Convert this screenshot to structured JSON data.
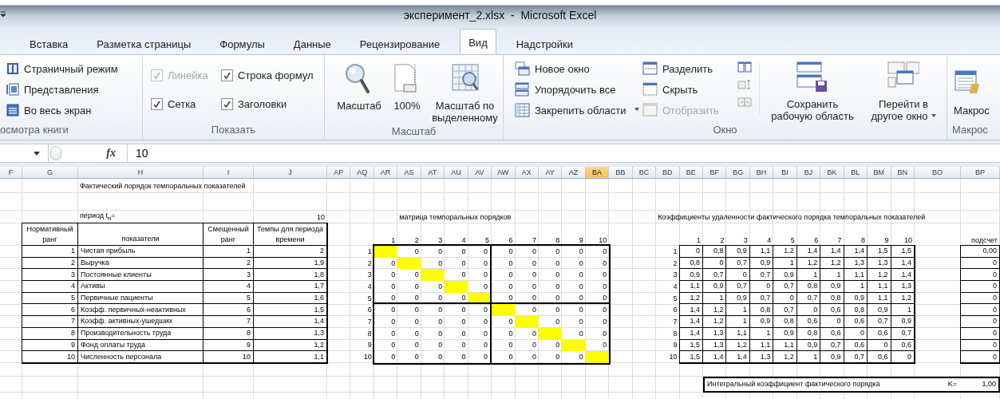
{
  "window": {
    "title": "эксперимент_2.xlsx  -  Microsoft Excel"
  },
  "ribbon_tabs": [
    {
      "label": "Вставка",
      "selected": false
    },
    {
      "label": "Разметка страницы",
      "selected": false
    },
    {
      "label": "Формулы",
      "selected": false
    },
    {
      "label": "Данные",
      "selected": false
    },
    {
      "label": "Рецензирование",
      "selected": false
    },
    {
      "label": "Вид",
      "selected": true
    },
    {
      "label": "Надстройки",
      "selected": false
    }
  ],
  "ribbon_groups": [
    {
      "kind": "views",
      "label": "осмотра книги",
      "items": [
        {
          "label": "Страничный режим"
        },
        {
          "label": "Представления"
        },
        {
          "label": "Во весь экран"
        }
      ]
    },
    {
      "kind": "show",
      "label": "Показать",
      "items": [
        {
          "label": "Линейка",
          "checked": true,
          "disabled": true
        },
        {
          "label": "Строка формул",
          "checked": true,
          "disabled": false
        },
        {
          "label": "Сетка",
          "checked": true,
          "disabled": false
        },
        {
          "label": "Заголовки",
          "checked": true,
          "disabled": false
        }
      ]
    },
    {
      "kind": "zoom",
      "label": "Масштаб",
      "items": [
        {
          "label": "Масштаб"
        },
        {
          "label": "100%"
        },
        {
          "label": "Масштаб по выделенному"
        }
      ]
    },
    {
      "kind": "window",
      "label": "Окно",
      "items": [
        {
          "label": "Новое окно",
          "disabled": false,
          "menu": false
        },
        {
          "label": "Упорядочить все",
          "disabled": false,
          "menu": false
        },
        {
          "label": "Закрепить области",
          "disabled": false,
          "menu": true
        },
        {
          "label": "Разделить",
          "disabled": false,
          "menu": false
        },
        {
          "label": "Скрыть",
          "disabled": false,
          "menu": false
        },
        {
          "label": "Отобразить",
          "disabled": true,
          "menu": false
        },
        {
          "label": "Сохранить рабочую область",
          "disabled": false,
          "menu": false
        },
        {
          "label": "Перейти в другое окно",
          "disabled": false,
          "menu": true
        }
      ]
    },
    {
      "kind": "macros",
      "label": "Макрос",
      "items": [
        {
          "label": "Макрос"
        }
      ]
    }
  ],
  "formula_bar": {
    "function_label": "fx",
    "value": "10"
  },
  "columns": [
    {
      "label": "F",
      "selected": false
    },
    {
      "label": "G",
      "selected": false
    },
    {
      "label": "H",
      "selected": false
    },
    {
      "label": "I",
      "selected": false
    },
    {
      "label": "J",
      "selected": false
    },
    {
      "label": "AP",
      "selected": false
    },
    {
      "label": "AQ",
      "selected": false
    },
    {
      "label": "AR",
      "selected": false
    },
    {
      "label": "AS",
      "selected": false
    },
    {
      "label": "AT",
      "selected": false
    },
    {
      "label": "AU",
      "selected": false
    },
    {
      "label": "AV",
      "selected": false
    },
    {
      "label": "AW",
      "selected": false
    },
    {
      "label": "AX",
      "selected": false
    },
    {
      "label": "AY",
      "selected": false
    },
    {
      "label": "AZ",
      "selected": false
    },
    {
      "label": "BA",
      "selected": true
    },
    {
      "label": "BB",
      "selected": false
    },
    {
      "label": "BC",
      "selected": false
    },
    {
      "label": "BD",
      "selected": false
    },
    {
      "label": "BE",
      "selected": false
    },
    {
      "label": "BF",
      "selected": false
    },
    {
      "label": "BG",
      "selected": false
    },
    {
      "label": "BH",
      "selected": false
    },
    {
      "label": "BI",
      "selected": false
    },
    {
      "label": "BJ",
      "selected": false
    },
    {
      "label": "BK",
      "selected": false
    },
    {
      "label": "BL",
      "selected": false
    },
    {
      "label": "BM",
      "selected": false
    },
    {
      "label": "BN",
      "selected": false
    },
    {
      "label": "BO",
      "selected": false
    },
    {
      "label": "BP",
      "selected": false
    }
  ],
  "report": {
    "title": "Фактический порядок темпоральных показателей",
    "period_label": "период t$_{н}$=",
    "period_value": "10",
    "headers": [
      "Нормативный ранг",
      "показатели",
      "Смещенный ранг",
      "Темпы для периода времени"
    ],
    "rows": [
      [
        "1",
        "Чистая прибыль",
        "1",
        "2"
      ],
      [
        "2",
        "Выручка",
        "2",
        "1,9"
      ],
      [
        "3",
        "Постоянные клиенты",
        "3",
        "1,8"
      ],
      [
        "4",
        "Активы",
        "4",
        "1,7"
      ],
      [
        "5",
        "Первичные пациенты",
        "5",
        "1,6"
      ],
      [
        "6",
        "Коэфф. первичных-неактивных",
        "6",
        "1,5"
      ],
      [
        "7",
        "Коэфф. активных-ушедших",
        "7",
        "1,4"
      ],
      [
        "8",
        "Производительность труда",
        "8",
        "1,3"
      ],
      [
        "9",
        "Фонд оплаты труда",
        "9",
        "1,2"
      ],
      [
        "10",
        "Численность персонала",
        "10",
        "1,1"
      ]
    ]
  },
  "order_matrix": {
    "title": "матрица темпоральных порядков",
    "column_labels": [
      "1",
      "2",
      "3",
      "4",
      "5",
      "6",
      "7",
      "8",
      "9",
      "10"
    ],
    "rows": [
      {
        "label": "1",
        "cells": [
          {
            "highlighted": true
          },
          {
            "value": "0",
            "highlighted": false
          },
          {
            "value": "0",
            "highlighted": false
          },
          {
            "value": "0",
            "highlighted": false
          },
          {
            "value": "0",
            "highlighted": false
          },
          {
            "value": "0",
            "highlighted": false
          },
          {
            "value": "0",
            "highlighted": false
          },
          {
            "value": "0",
            "highlighted": false
          },
          {
            "value": "0",
            "highlighted": false
          },
          {
            "value": "0",
            "highlighted": false
          }
        ]
      },
      {
        "label": "2",
        "cells": [
          {
            "value": "0",
            "highlighted": false
          },
          {
            "highlighted": true
          },
          {
            "value": "0",
            "highlighted": false
          },
          {
            "value": "0",
            "highlighted": false
          },
          {
            "value": "0",
            "highlighted": false
          },
          {
            "value": "0",
            "highlighted": false
          },
          {
            "value": "0",
            "highlighted": false
          },
          {
            "value": "0",
            "highlighted": false
          },
          {
            "value": "0",
            "highlighted": false
          },
          {
            "value": "0",
            "highlighted": false
          }
        ]
      },
      {
        "label": "3",
        "cells": [
          {
            "value": "0",
            "highlighted": false
          },
          {
            "value": "0",
            "highlighted": false
          },
          {
            "highlighted": true
          },
          {
            "value": "0",
            "highlighted": false
          },
          {
            "value": "0",
            "highlighted": false
          },
          {
            "value": "0",
            "highlighted": false
          },
          {
            "value": "0",
            "highlighted": false
          },
          {
            "value": "0",
            "highlighted": false
          },
          {
            "value": "0",
            "highlighted": false
          },
          {
            "value": "0",
            "highlighted": false
          }
        ]
      },
      {
        "label": "4",
        "cells": [
          {
            "value": "0",
            "highlighted": false
          },
          {
            "value": "0",
            "highlighted": false
          },
          {
            "value": "0",
            "highlighted": false
          },
          {
            "highlighted": true
          },
          {
            "value": "0",
            "highlighted": false
          },
          {
            "value": "0",
            "highlighted": false
          },
          {
            "value": "0",
            "highlighted": false
          },
          {
            "value": "0",
            "highlighted": false
          },
          {
            "value": "0",
            "highlighted": false
          },
          {
            "value": "0",
            "highlighted": false
          }
        ]
      },
      {
        "label": "5",
        "cells": [
          {
            "value": "0",
            "highlighted": false
          },
          {
            "value": "0",
            "highlighted": false
          },
          {
            "value": "0",
            "highlighted": false
          },
          {
            "value": "0",
            "highlighted": false
          },
          {
            "highlighted": true
          },
          {
            "value": "0",
            "highlighted": false
          },
          {
            "value": "0",
            "highlighted": false
          },
          {
            "value": "0",
            "highlighted": false
          },
          {
            "value": "0",
            "highlighted": false
          },
          {
            "value": "0",
            "highlighted": false
          }
        ]
      },
      {
        "label": "6",
        "cells": [
          {
            "value": "0",
            "highlighted": false
          },
          {
            "value": "0",
            "highlighted": false
          },
          {
            "value": "0",
            "highlighted": false
          },
          {
            "value": "0",
            "highlighted": false
          },
          {
            "value": "0",
            "highlighted": false
          },
          {
            "highlighted": true
          },
          {
            "value": "0",
            "highlighted": false
          },
          {
            "value": "0",
            "highlighted": false
          },
          {
            "value": "0",
            "highlighted": false
          },
          {
            "value": "0",
            "highlighted": false
          }
        ]
      },
      {
        "label": "7",
        "cells": [
          {
            "value": "0",
            "highlighted": false
          },
          {
            "value": "0",
            "highlighted": false
          },
          {
            "value": "0",
            "highlighted": false
          },
          {
            "value": "0",
            "highlighted": false
          },
          {
            "value": "0",
            "highlighted": false
          },
          {
            "value": "0",
            "highlighted": false
          },
          {
            "highlighted": true
          },
          {
            "value": "0",
            "highlighted": false
          },
          {
            "value": "0",
            "highlighted": false
          },
          {
            "value": "0",
            "highlighted": false
          }
        ]
      },
      {
        "label": "8",
        "cells": [
          {
            "value": "0",
            "highlighted": false
          },
          {
            "value": "0",
            "highlighted": false
          },
          {
            "value": "0",
            "highlighted": false
          },
          {
            "value": "0",
            "highlighted": false
          },
          {
            "value": "0",
            "highlighted": false
          },
          {
            "value": "0",
            "highlighted": false
          },
          {
            "value": "0",
            "highlighted": false
          },
          {
            "highlighted": true
          },
          {
            "value": "0",
            "highlighted": false
          },
          {
            "value": "0",
            "highlighted": false
          }
        ]
      },
      {
        "label": "9",
        "cells": [
          {
            "value": "0",
            "highlighted": false
          },
          {
            "value": "0",
            "highlighted": false
          },
          {
            "value": "0",
            "highlighted": false
          },
          {
            "value": "0",
            "highlighted": false
          },
          {
            "value": "0",
            "highlighted": false
          },
          {
            "value": "0",
            "highlighted": false
          },
          {
            "value": "0",
            "highlighted": false
          },
          {
            "value": "0",
            "highlighted": false
          },
          {
            "highlighted": true
          },
          {
            "value": "0",
            "highlighted": false
          }
        ]
      },
      {
        "label": "10",
        "cells": [
          {
            "value": "0",
            "highlighted": false
          },
          {
            "value": "0",
            "highlighted": false
          },
          {
            "value": "0",
            "highlighted": false
          },
          {
            "value": "0",
            "highlighted": false
          },
          {
            "value": "0",
            "highlighted": false
          },
          {
            "value": "0",
            "highlighted": false
          },
          {
            "value": "0",
            "highlighted": false
          },
          {
            "value": "0",
            "highlighted": false
          },
          {
            "value": "0",
            "highlighted": false
          },
          {
            "highlighted": true
          }
        ]
      }
    ]
  },
  "distance_matrix": {
    "title": "Коэффициенты удаленности фактического порядка темпоральных показателей",
    "column_labels": [
      "1",
      "2",
      "3",
      "4",
      "5",
      "6",
      "7",
      "8",
      "9",
      "10"
    ],
    "rows": [
      {
        "label": "1",
        "values": [
          "0",
          "0,8",
          "0,9",
          "1,1",
          "1,2",
          "1,4",
          "1,4",
          "1,4",
          "1,5",
          "1,5"
        ]
      },
      {
        "label": "2",
        "values": [
          "0,8",
          "0",
          "0,7",
          "0,9",
          "1",
          "1,2",
          "1,2",
          "1,3",
          "1,3",
          "1,4"
        ]
      },
      {
        "label": "3",
        "values": [
          "0,9",
          "0,7",
          "0",
          "0,7",
          "0,9",
          "1",
          "1",
          "1,1",
          "1,2",
          "1,4"
        ]
      },
      {
        "label": "4",
        "values": [
          "1,1",
          "0,9",
          "0,7",
          "0",
          "0,7",
          "0,8",
          "0,9",
          "1",
          "1,1",
          "1,3"
        ]
      },
      {
        "label": "5",
        "values": [
          "1,2",
          "1",
          "0,9",
          "0,7",
          "0",
          "0,7",
          "0,8",
          "0,9",
          "1,1",
          "1,2"
        ]
      },
      {
        "label": "6",
        "values": [
          "1,4",
          "1,2",
          "1",
          "0,8",
          "0,7",
          "0",
          "0,6",
          "0,8",
          "0,9",
          "1"
        ]
      },
      {
        "label": "7",
        "values": [
          "1,4",
          "1,2",
          "1",
          "0,9",
          "0,8",
          "0,6",
          "0",
          "0,6",
          "0,7",
          "0,9"
        ]
      },
      {
        "label": "8",
        "values": [
          "1,4",
          "1,3",
          "1,1",
          "1",
          "0,9",
          "0,8",
          "0,6",
          "0",
          "0,6",
          "0,7"
        ]
      },
      {
        "label": "9",
        "values": [
          "1,5",
          "1,3",
          "1,2",
          "1,1",
          "1,1",
          "0,9",
          "0,7",
          "0,6",
          "0",
          "0,6"
        ]
      },
      {
        "label": "10",
        "values": [
          "1,5",
          "1,4",
          "1,4",
          "1,3",
          "1,2",
          "1",
          "0,9",
          "0,7",
          "0,6",
          "0"
        ]
      }
    ]
  },
  "count": {
    "label": "подсчет",
    "values": [
      "0,00",
      "0",
      "0",
      "0",
      "0",
      "0",
      "0",
      "0",
      "0",
      "0"
    ]
  },
  "integral": {
    "label": "Интегральный коэффициент фактического порядка",
    "k_label": "K=",
    "value": "1,00"
  }
}
